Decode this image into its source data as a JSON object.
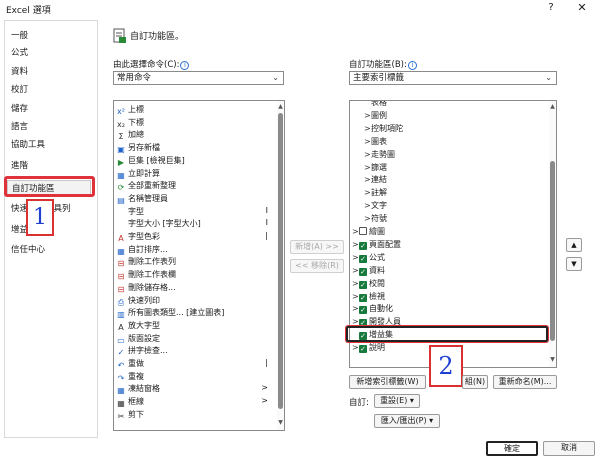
{
  "window": {
    "title": "Excel 選項",
    "help": "?",
    "close": "✕"
  },
  "sidebar": {
    "items": [
      {
        "label": "一般"
      },
      {
        "label": "公式"
      },
      {
        "label": "資料"
      },
      {
        "label": "校訂"
      },
      {
        "label": "儲存"
      },
      {
        "label": "語言"
      },
      {
        "label": "協助工具"
      },
      {
        "label": "進階"
      },
      {
        "label": "自訂功能區"
      },
      {
        "label": "快速存取工具列"
      },
      {
        "label": "增益集"
      },
      {
        "label": "信任中心"
      }
    ],
    "selected": "自訂功能區"
  },
  "heading": "自訂功能區。",
  "left": {
    "choose_label": "由此選擇命令(C):",
    "choose_value": "常用命令",
    "commands": [
      {
        "icon": "x²",
        "label": "上標",
        "sub": ""
      },
      {
        "icon": "x₂",
        "label": "下標",
        "sub": ""
      },
      {
        "icon": "Σ",
        "label": "加總",
        "sub": ""
      },
      {
        "icon": "▣",
        "label": "另存新檔",
        "sub": ""
      },
      {
        "icon": "▶",
        "label": "巨集 [檢視巨集]",
        "sub": ""
      },
      {
        "icon": "▦",
        "label": "立即計算",
        "sub": ""
      },
      {
        "icon": "⟳",
        "label": "全部重新整理",
        "sub": ""
      },
      {
        "icon": "▤",
        "label": "名稱管理員",
        "sub": ""
      },
      {
        "icon": "",
        "label": "字型",
        "sub": "I"
      },
      {
        "icon": "",
        "label": "字型大小 [字型大小]",
        "sub": "I"
      },
      {
        "icon": "A",
        "label": "字型色彩",
        "sub": "|"
      },
      {
        "icon": "▦",
        "label": "自訂排序...",
        "sub": ""
      },
      {
        "icon": "⊟",
        "label": "刪除工作表列",
        "sub": ""
      },
      {
        "icon": "⊟",
        "label": "刪除工作表欄",
        "sub": ""
      },
      {
        "icon": "⊟",
        "label": "刪除儲存格...",
        "sub": ""
      },
      {
        "icon": "⎙",
        "label": "快速列印",
        "sub": ""
      },
      {
        "icon": "▥",
        "label": "所有圖表類型... [建立圖表]",
        "sub": ""
      },
      {
        "icon": "A",
        "label": "放大字型",
        "sub": ""
      },
      {
        "icon": "▭",
        "label": "版面設定",
        "sub": ""
      },
      {
        "icon": "✓",
        "label": "拼字檢查...",
        "sub": ""
      },
      {
        "icon": "↶",
        "label": "重做",
        "sub": "|"
      },
      {
        "icon": "↷",
        "label": "重複",
        "sub": ""
      },
      {
        "icon": "▦",
        "label": "凍結窗格",
        "sub": ">"
      },
      {
        "icon": "▦",
        "label": "框線",
        "sub": ">"
      },
      {
        "icon": "✂",
        "label": "剪下",
        "sub": ""
      }
    ]
  },
  "middle": {
    "add_label": "新增(A) >>",
    "remove_label": "<< 移除(R)"
  },
  "right": {
    "customize_label": "自訂功能區(B):",
    "customize_value": "主要索引標籤",
    "tree": [
      {
        "exp": "",
        "chk": "",
        "label": "表格"
      },
      {
        "exp": ">",
        "chk": "",
        "label": "圖例"
      },
      {
        "exp": ">",
        "chk": "",
        "label": "控制項陀"
      },
      {
        "exp": ">",
        "chk": "",
        "label": "圖表"
      },
      {
        "exp": ">",
        "chk": "",
        "label": "走勢圖"
      },
      {
        "exp": ">",
        "chk": "",
        "label": "篩選"
      },
      {
        "exp": ">",
        "chk": "",
        "label": "連結"
      },
      {
        "exp": ">",
        "chk": "",
        "label": "註解"
      },
      {
        "exp": ">",
        "chk": "",
        "label": "文字"
      },
      {
        "exp": ">",
        "chk": "",
        "label": "符號"
      },
      {
        "exp": ">",
        "chk": "off",
        "label": "繪圖"
      },
      {
        "exp": ">",
        "chk": "on",
        "label": "頁面配置"
      },
      {
        "exp": ">",
        "chk": "on",
        "label": "公式"
      },
      {
        "exp": ">",
        "chk": "on",
        "label": "資料"
      },
      {
        "exp": ">",
        "chk": "on",
        "label": "校閱"
      },
      {
        "exp": ">",
        "chk": "on",
        "label": "檢視"
      },
      {
        "exp": ">",
        "chk": "on",
        "label": "自動化"
      },
      {
        "exp": ">",
        "chk": "on",
        "label": "開發人員"
      },
      {
        "exp": "",
        "chk": "on",
        "label": "增益集"
      },
      {
        "exp": ">",
        "chk": "on",
        "label": "說明"
      }
    ],
    "highlighted": "開發人員",
    "new_tab": "新增索引標籤(W)",
    "new_group": "組(N)",
    "rename": "重新命名(M)...",
    "customize_short": "自訂:",
    "reset": "重設(E) ▾",
    "import_export": "匯入/匯出(P) ▾"
  },
  "updown": {
    "up": "▲",
    "down": "▼"
  },
  "footer": {
    "ok": "確定",
    "cancel": "取消"
  },
  "callouts": {
    "one": "1",
    "two": "2"
  }
}
